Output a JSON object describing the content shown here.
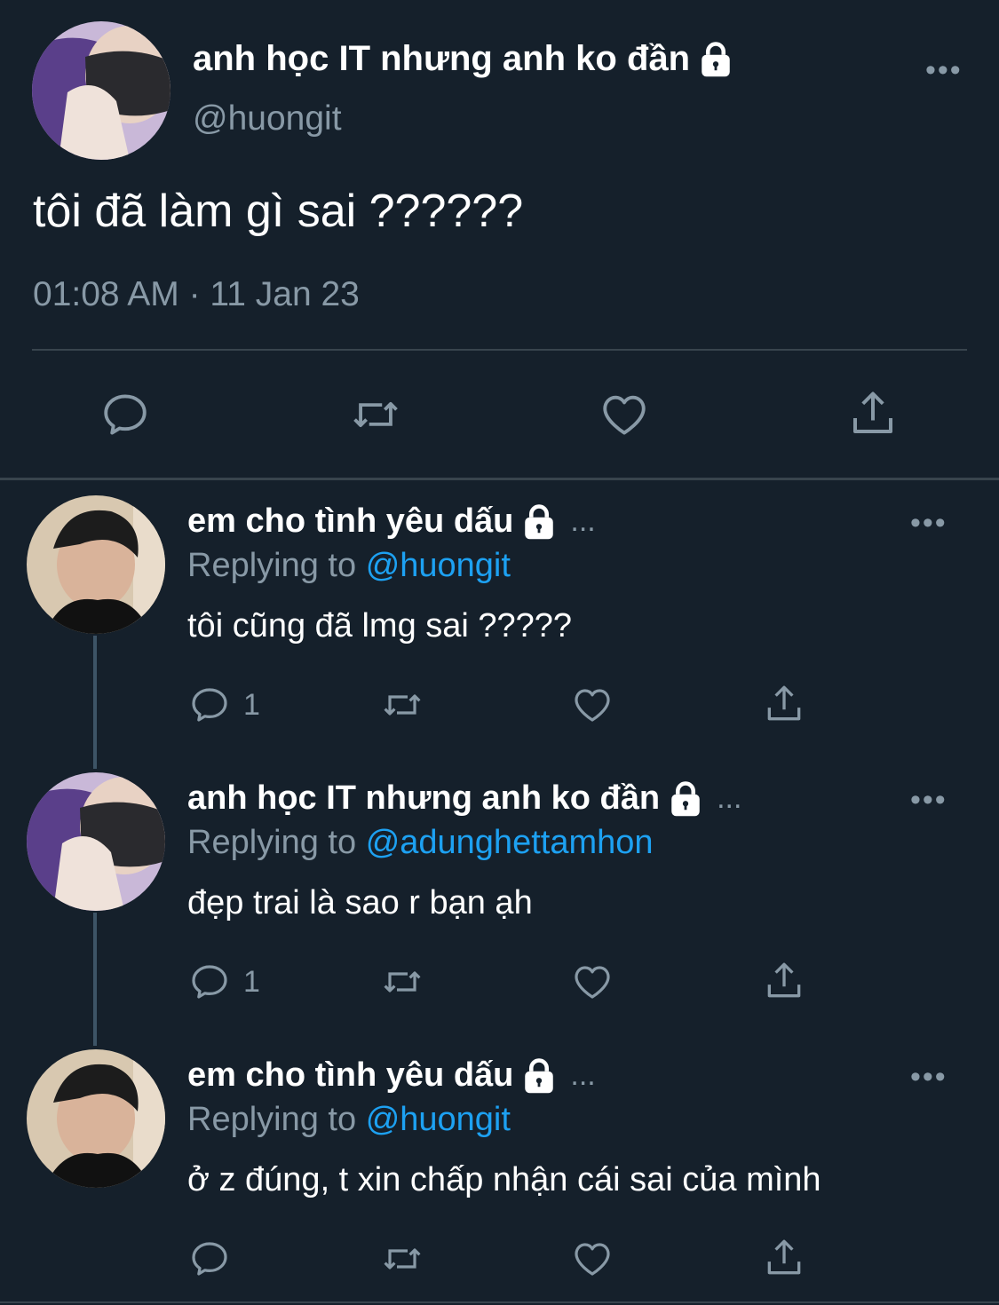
{
  "main_tweet": {
    "display_name": "anh học IT nhưng anh ko đần",
    "handle": "@huongit",
    "text": "tôi đã làm gì sai ??????",
    "timestamp": "01:08 AM · 11 Jan 23",
    "more": "•••"
  },
  "icons": {
    "reply": "reply-icon",
    "retweet": "retweet-icon",
    "like": "heart-icon",
    "share": "share-icon",
    "lock": "lock-icon"
  },
  "replies": [
    {
      "display_name": "em cho tình yêu dấu",
      "truncation": "...",
      "replying_label": "Replying to",
      "replying_to": "@huongit",
      "text": "tôi cũng đã lmg sai ?????",
      "reply_count": "1",
      "more": "•••"
    },
    {
      "display_name": "anh học IT nhưng anh ko đần",
      "truncation": "...",
      "replying_label": "Replying to",
      "replying_to": "@adunghettamhon",
      "text": "đẹp trai là sao r bạn ạh",
      "reply_count": "1",
      "more": "•••"
    },
    {
      "display_name": "em cho tình yêu dấu",
      "truncation": "...",
      "replying_label": "Replying to",
      "replying_to": "@huongit",
      "text": "ở z đúng, t xin chấp nhận cái sai của mình",
      "reply_count": "",
      "more": "•••"
    }
  ]
}
